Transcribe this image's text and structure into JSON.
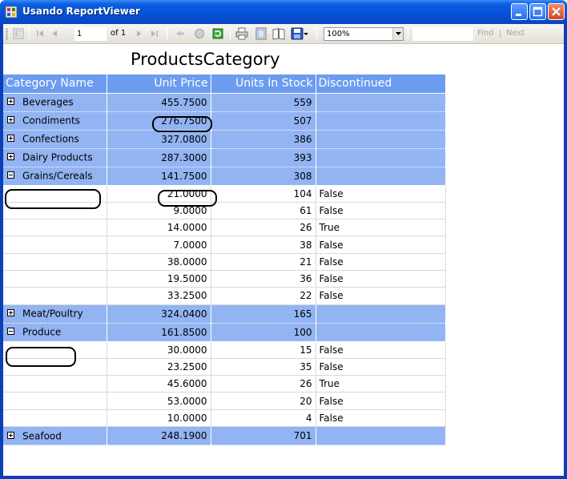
{
  "window": {
    "title": "Usando ReportViewer"
  },
  "toolbar": {
    "page_current": "1",
    "page_of": "of  1",
    "zoom": "100%",
    "find_label": "Find",
    "find_separator": "|",
    "next_label": "Next"
  },
  "report": {
    "title": "ProductsCategory",
    "columns": [
      "Category Name",
      "Unit Price",
      "Units In Stock",
      "Discontinued"
    ],
    "groups": [
      {
        "name": "Beverages",
        "expanded": false,
        "unit_price": "455.7500",
        "units_in_stock": "559",
        "details": []
      },
      {
        "name": "Condiments",
        "expanded": false,
        "unit_price": "276.7500",
        "units_in_stock": "507",
        "details": []
      },
      {
        "name": "Confections",
        "expanded": false,
        "unit_price": "327.0800",
        "units_in_stock": "386",
        "details": []
      },
      {
        "name": "Dairy Products",
        "expanded": false,
        "unit_price": "287.3000",
        "units_in_stock": "393",
        "details": []
      },
      {
        "name": "Grains/Cereals",
        "expanded": true,
        "unit_price": "141.7500",
        "units_in_stock": "308",
        "details": [
          {
            "unit_price": "21.0000",
            "units_in_stock": "104",
            "discontinued": "False"
          },
          {
            "unit_price": "9.0000",
            "units_in_stock": "61",
            "discontinued": "False"
          },
          {
            "unit_price": "14.0000",
            "units_in_stock": "26",
            "discontinued": "True"
          },
          {
            "unit_price": "7.0000",
            "units_in_stock": "38",
            "discontinued": "False"
          },
          {
            "unit_price": "38.0000",
            "units_in_stock": "21",
            "discontinued": "False"
          },
          {
            "unit_price": "19.5000",
            "units_in_stock": "36",
            "discontinued": "False"
          },
          {
            "unit_price": "33.2500",
            "units_in_stock": "22",
            "discontinued": "False"
          }
        ]
      },
      {
        "name": "Meat/Poultry",
        "expanded": false,
        "unit_price": "324.0400",
        "units_in_stock": "165",
        "details": []
      },
      {
        "name": "Produce",
        "expanded": true,
        "unit_price": "161.8500",
        "units_in_stock": "100",
        "details": [
          {
            "unit_price": "30.0000",
            "units_in_stock": "15",
            "discontinued": "False"
          },
          {
            "unit_price": "23.2500",
            "units_in_stock": "35",
            "discontinued": "False"
          },
          {
            "unit_price": "45.6000",
            "units_in_stock": "26",
            "discontinued": "True"
          },
          {
            "unit_price": "53.0000",
            "units_in_stock": "20",
            "discontinued": "False"
          },
          {
            "unit_price": "10.0000",
            "units_in_stock": "4",
            "discontinued": "False"
          }
        ]
      },
      {
        "name": "Seafood",
        "expanded": false,
        "unit_price": "248.1900",
        "units_in_stock": "701",
        "details": []
      }
    ]
  }
}
